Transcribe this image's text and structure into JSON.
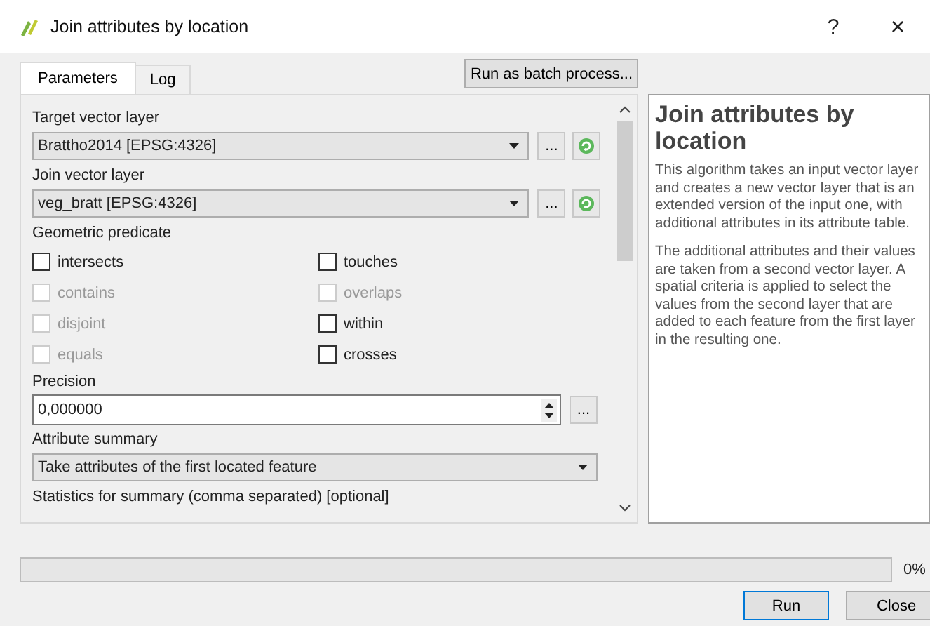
{
  "window": {
    "title": "Join attributes by location",
    "help_button": "?",
    "close_button": "×"
  },
  "tabs": [
    {
      "label": "Parameters",
      "selected": true
    },
    {
      "label": "Log",
      "selected": false
    }
  ],
  "batch_button": "Run as batch process...",
  "parameters": {
    "target_layer": {
      "label": "Target vector layer",
      "value": "Brattho2014 [EPSG:4326]",
      "browse": "..."
    },
    "join_layer": {
      "label": "Join vector layer",
      "value": "veg_bratt [EPSG:4326]",
      "browse": "..."
    },
    "predicate_label": "Geometric predicate",
    "predicates": [
      {
        "label": "intersects",
        "checked": false,
        "disabled": false
      },
      {
        "label": "touches",
        "checked": false,
        "disabled": false
      },
      {
        "label": "contains",
        "checked": false,
        "disabled": true
      },
      {
        "label": "overlaps",
        "checked": false,
        "disabled": true
      },
      {
        "label": "disjoint",
        "checked": false,
        "disabled": true
      },
      {
        "label": "within",
        "checked": false,
        "disabled": false
      },
      {
        "label": "equals",
        "checked": false,
        "disabled": true
      },
      {
        "label": "crosses",
        "checked": false,
        "disabled": false
      }
    ],
    "precision": {
      "label": "Precision",
      "value": "0,000000",
      "browse": "..."
    },
    "summary": {
      "label": "Attribute summary",
      "value": "Take attributes of the first located feature"
    },
    "statistics_label": "Statistics for summary (comma separated) [optional]"
  },
  "help": {
    "title": "Join attributes by location",
    "paragraphs": [
      "This algorithm takes an input vector layer and creates a new vector layer that is an extended version of the input one, with additional attributes in its attribute table.",
      "The additional attributes and their values are taken from a second vector layer. A spatial criteria is applied to select the values from the second layer that are added to each feature from the first layer in the resulting one."
    ]
  },
  "progress": {
    "level": 0,
    "reading": "0%"
  },
  "buttons": [
    "Run",
    "Close"
  ]
}
